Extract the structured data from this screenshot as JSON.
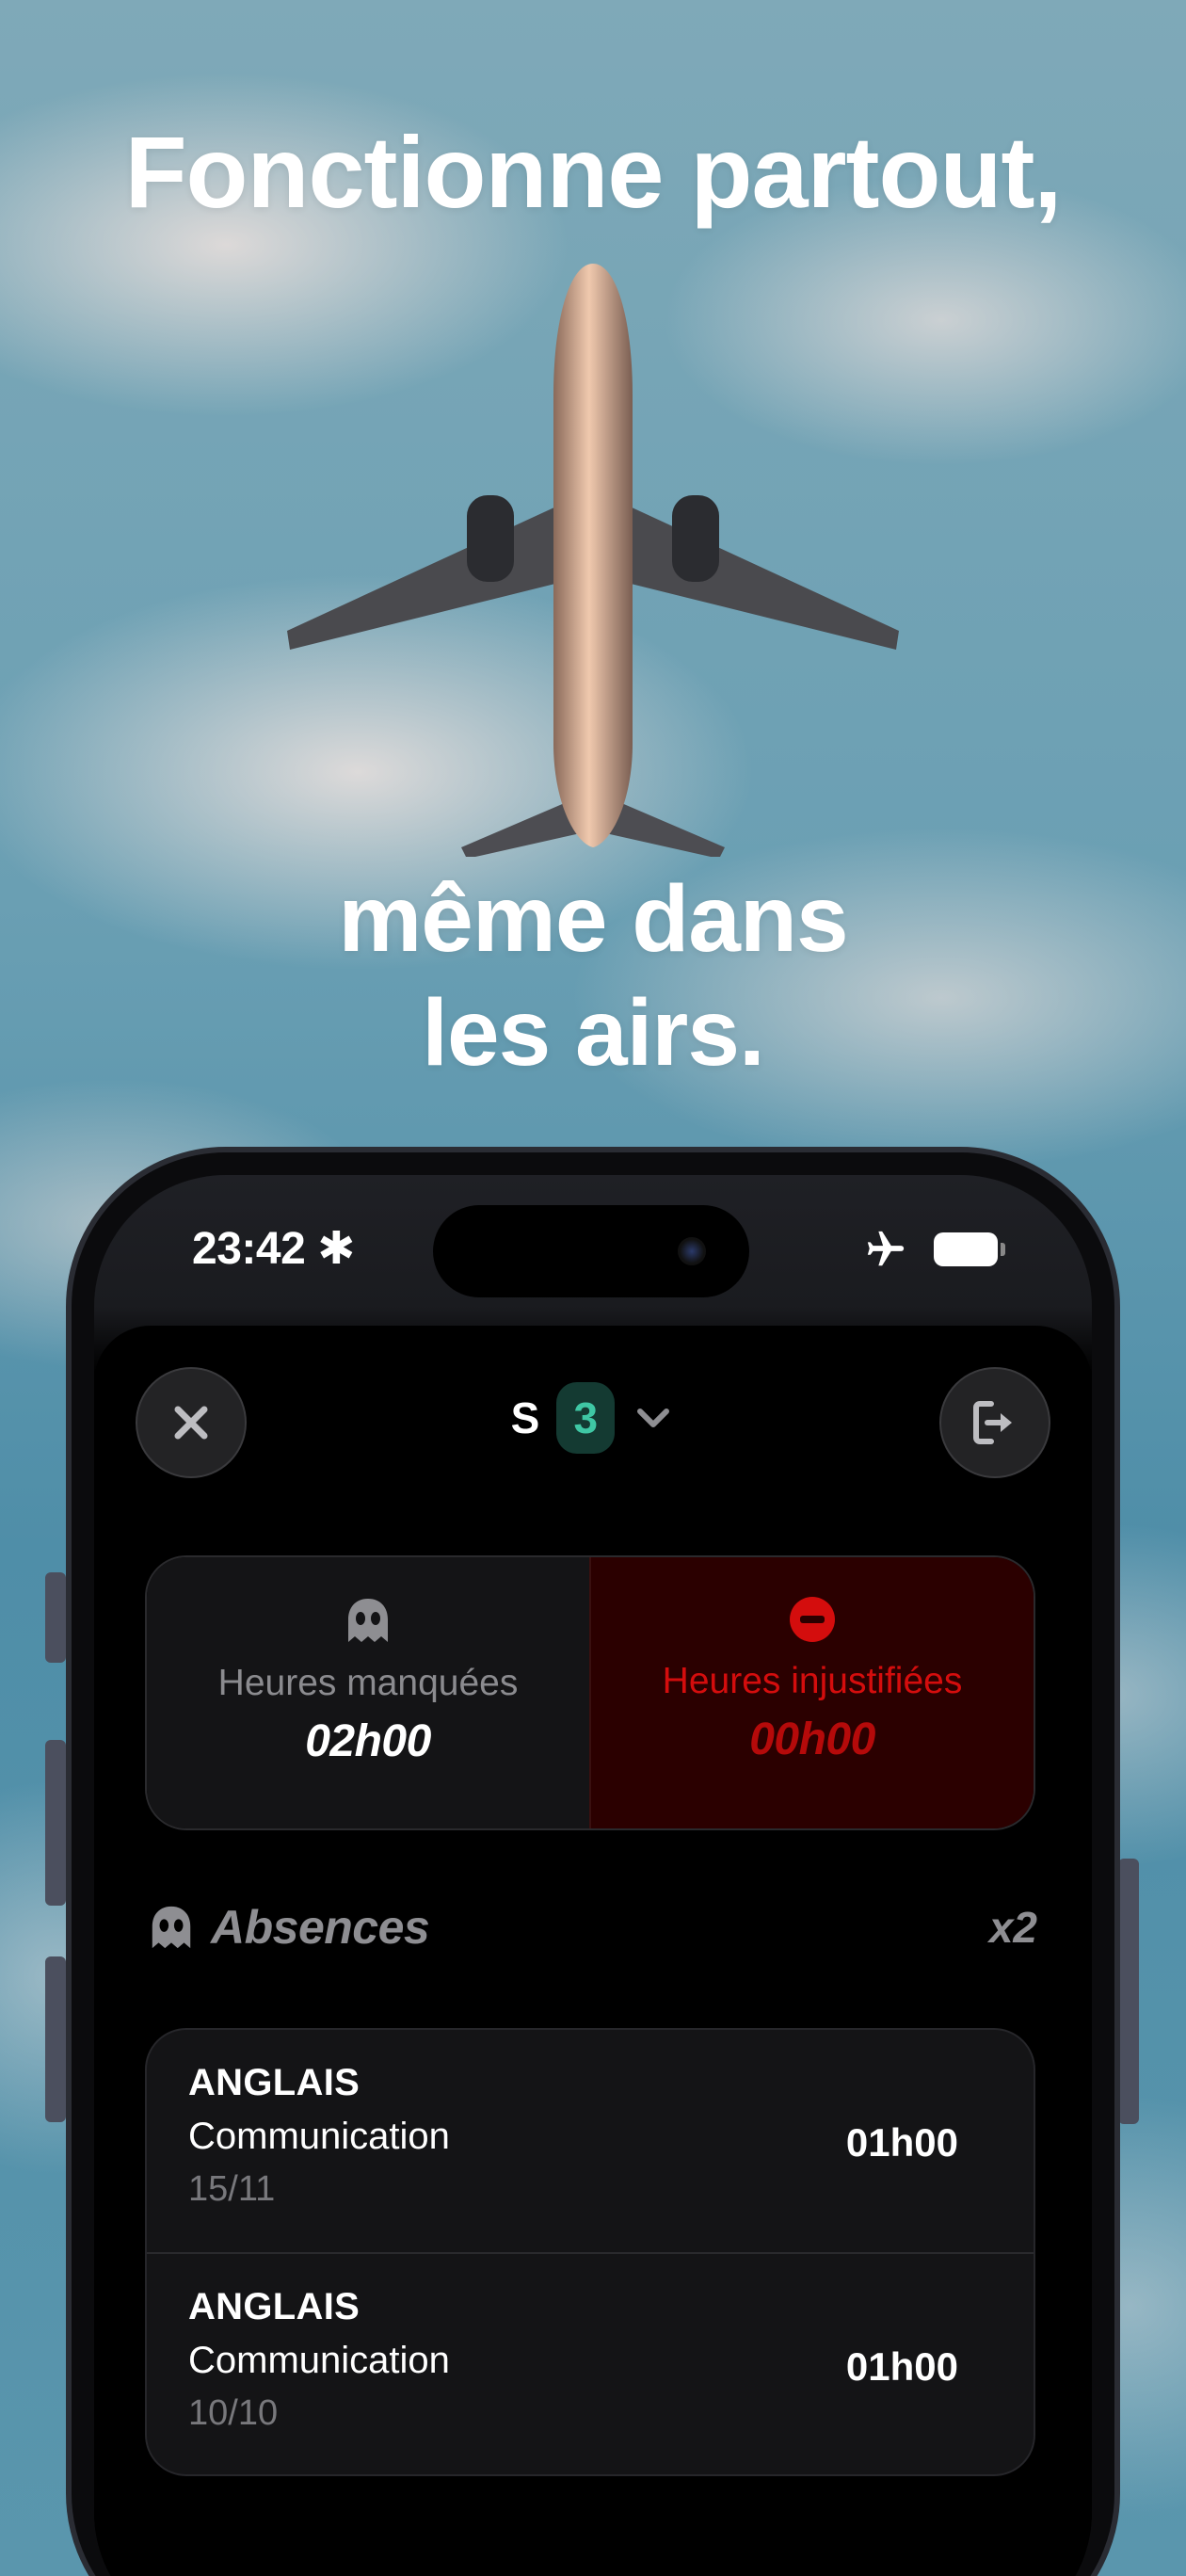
{
  "headline": {
    "line1": "Fonctionne partout,",
    "line2": "même dans",
    "line3": "les airs."
  },
  "status_bar": {
    "time": "23:42",
    "airplane_icon": "airplane-icon",
    "battery_icon": "battery-icon"
  },
  "header": {
    "semester_prefix": "S",
    "semester_number": "3",
    "accent": "#3fc7a4"
  },
  "stats": {
    "missed": {
      "label": "Heures manquées",
      "value": "02h00"
    },
    "unjustified": {
      "label": "Heures injustifiées",
      "value": "00h00",
      "color": "#d40d0d"
    }
  },
  "absences": {
    "title": "Absences",
    "count": "x2",
    "items": [
      {
        "subject": "ANGLAIS",
        "type": "Communication",
        "date": "15/11",
        "duration": "01h00"
      },
      {
        "subject": "ANGLAIS",
        "type": "Communication",
        "date": "10/10",
        "duration": "01h00"
      }
    ]
  }
}
